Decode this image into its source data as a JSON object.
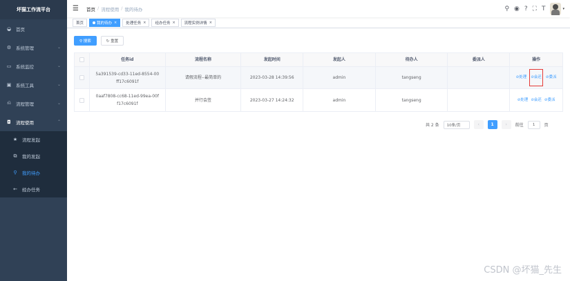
{
  "app": {
    "title": "坏猫工作流平台"
  },
  "sidebar": {
    "items": [
      {
        "label": "首页",
        "icon": "dashboard-icon",
        "glyph": "◒"
      },
      {
        "label": "系统管理",
        "icon": "gear-icon",
        "glyph": "⚙",
        "arrow": "⌄"
      },
      {
        "label": "系统监控",
        "icon": "monitor-icon",
        "glyph": "▭",
        "arrow": "⌄"
      },
      {
        "label": "系统工具",
        "icon": "toolbox-icon",
        "glyph": "▣",
        "arrow": "⌄"
      },
      {
        "label": "流程管理",
        "icon": "workflow-icon",
        "glyph": "⎌",
        "arrow": "⌄"
      },
      {
        "label": "流程使用",
        "icon": "process-icon",
        "glyph": "◘",
        "arrow": "⌃"
      }
    ],
    "subitems": [
      {
        "label": "流程发起",
        "icon": "star-icon",
        "glyph": "★"
      },
      {
        "label": "我的发起",
        "icon": "edit-icon",
        "glyph": "⧉"
      },
      {
        "label": "我的待办",
        "icon": "todo-icon",
        "glyph": "⚲"
      },
      {
        "label": "经办任务",
        "icon": "back-arrow-icon",
        "glyph": "←"
      }
    ]
  },
  "header": {
    "breadcrumb": {
      "home": "首页",
      "sep": "/",
      "level1": "流程使用",
      "current": "我的待办"
    },
    "icons": [
      {
        "name": "search-icon",
        "glyph": "⚲"
      },
      {
        "name": "github-icon",
        "glyph": "◉"
      },
      {
        "name": "help-icon",
        "glyph": "?"
      },
      {
        "name": "fullscreen-icon",
        "glyph": "⛶"
      },
      {
        "name": "font-size-icon",
        "glyph": "T"
      }
    ],
    "hamburger": "☰",
    "caret": "▾"
  },
  "tags": [
    {
      "label": "首页",
      "active": false,
      "closable": false
    },
    {
      "label": "我的待办",
      "active": true,
      "closable": true
    },
    {
      "label": "处理任务",
      "active": false,
      "closable": true
    },
    {
      "label": "经办任务",
      "active": false,
      "closable": true
    },
    {
      "label": "流程实例详情",
      "active": false,
      "closable": true
    }
  ],
  "tag_close": "×",
  "toolbar": {
    "search_label": "⚲ 搜索",
    "reset_label": "↻ 重置"
  },
  "table": {
    "headers": [
      "任务id",
      "流程名称",
      "发起时间",
      "发起人",
      "待办人",
      "委派人",
      "操作"
    ],
    "rows": [
      {
        "id_line1": "5a391539-cd33-11ed-8554-00",
        "id_line2": "ff17c6091f",
        "name": "请假流程--最简单的",
        "time": "2023-03-28 14:39:56",
        "starter": "admin",
        "assignee": "tangseng",
        "delegate": "",
        "ops": [
          "⊘处理",
          "⊘会还",
          "⊘委派"
        ]
      },
      {
        "id_line1": "0aaf7808-cc68-11ed-99ea-00f",
        "id_line2": "f17c6091f",
        "name": "并行会签",
        "time": "2023-03-27 14:24:32",
        "starter": "admin",
        "assignee": "tangseng",
        "delegate": "",
        "ops": [
          "⊘处理",
          "⊘会还",
          "⊘委派"
        ]
      }
    ]
  },
  "pagination": {
    "total": "共 2 条",
    "page_size": "10条/页",
    "prev": "‹",
    "current": "1",
    "next": "›",
    "goto_label": "前往",
    "goto_value": "1",
    "page_suffix": "页"
  },
  "watermark": "CSDN @坏猫_先生",
  "colors": {
    "sidebar_bg": "#304156",
    "accent": "#409eff",
    "highlight_box": "#e53935"
  }
}
